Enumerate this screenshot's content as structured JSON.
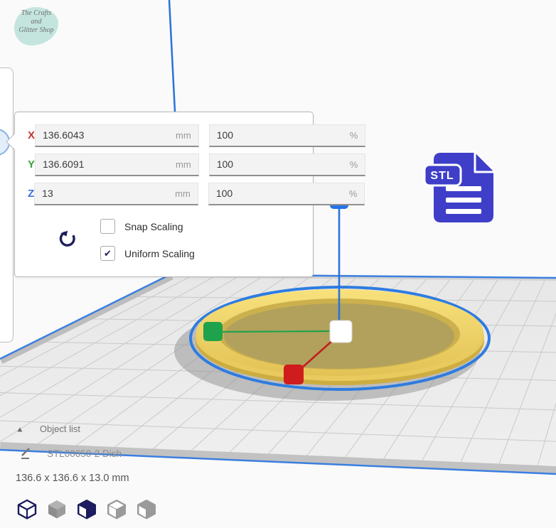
{
  "logo": {
    "line1": "The Crafts",
    "line2": "and",
    "line3": "Glitter Shop"
  },
  "scale_panel": {
    "rows": [
      {
        "axis": "X",
        "value": "136.6043",
        "unit": "mm",
        "percent": "100",
        "percent_unit": "%"
      },
      {
        "axis": "Y",
        "value": "136.6091",
        "unit": "mm",
        "percent": "100",
        "percent_unit": "%"
      },
      {
        "axis": "Z",
        "value": "13",
        "unit": "mm",
        "percent": "100",
        "percent_unit": "%"
      }
    ],
    "snap_label": "Snap Scaling",
    "uniform_label": "Uniform Scaling",
    "snap_checked": false,
    "uniform_checked": true,
    "snap_glyph": "",
    "uniform_glyph": "✔"
  },
  "stl_badge": {
    "label": "STL"
  },
  "object_list": {
    "header": "Object list",
    "item": "STL00650-2 Dish",
    "dimensions": "136.6 x 136.6 x 13.0 mm"
  },
  "icons": {
    "reset": "reset-scale-icon",
    "views": [
      "view-3d-icon",
      "view-front-icon",
      "view-top-icon",
      "view-left-icon",
      "view-right-icon"
    ]
  },
  "colors": {
    "axis_x": "#c4342e",
    "axis_y": "#3aa33a",
    "axis_z": "#3a6fd8",
    "selection_outline": "#2e7ce0",
    "handle_green": "#1ea24c",
    "handle_red": "#cf1d1d",
    "handle_blue": "#2574e8",
    "handle_white": "#ffffff",
    "model_yellow": "#eccd60",
    "stl_indigo": "#3e3ec9",
    "logo_teal": "#c3e5de"
  }
}
